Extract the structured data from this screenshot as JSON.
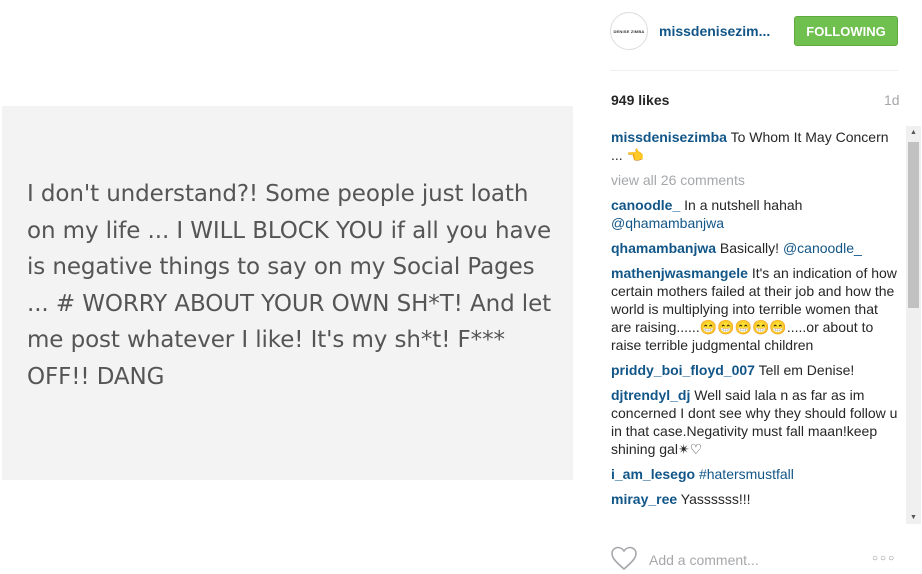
{
  "post": {
    "image_text": "I don't understand?! Some people just loath on my life ... I WILL BLOCK YOU if all you have is negative things to say on my Social Pages ... # WORRY ABOUT YOUR OWN SH*T! And let me post whatever I like! It's my sh*t! F*** OFF!!  DANG"
  },
  "header": {
    "avatar_text": "DENISE ZIMBA",
    "username": "missdenisezimba",
    "username_display": "missdenisezim...",
    "follow_label": "FOLLOWING"
  },
  "stats": {
    "likes": "949 likes",
    "time": "1d"
  },
  "caption": {
    "username": "missdenisezimba",
    "text": " To Whom It May Concern ... 👈"
  },
  "view_all": "view all 26 comments",
  "comments": [
    {
      "username": "canoodle_",
      "text": " In a nutshell hahah ",
      "mention": "@qhamambanjwa"
    },
    {
      "username": "qhamambanjwa",
      "text": " Basically! ",
      "mention": "@canoodle_"
    },
    {
      "username": "mathenjwasmangele",
      "text": " It's an indication of how certain mothers failed at their job and how the world is multiplying into terrible women that are raising......😁😁😁😁😁.....or about to raise terrible judgmental children",
      "mention": ""
    },
    {
      "username": "priddy_boi_floyd_007",
      "text": " Tell em Denise!",
      "mention": ""
    },
    {
      "username": "djtrendyl_dj",
      "text": " Well said lala n as far as im concerned I dont see why they should follow u in that case.Negativity must fall maan!keep shining gal✴♡",
      "mention": ""
    },
    {
      "username": "i_am_lesego",
      "text": " ",
      "mention": "#hatersmustfall"
    },
    {
      "username": "miray_ree",
      "text": " Yassssss!!!",
      "mention": ""
    }
  ],
  "footer": {
    "add_comment_placeholder": "Add a comment...",
    "more_label": "○○○"
  },
  "icons": {
    "heart": "heart-icon",
    "more": "more-options-icon"
  },
  "colors": {
    "link": "#125688",
    "follow_green": "#70c050",
    "muted": "#a5a7aa"
  }
}
